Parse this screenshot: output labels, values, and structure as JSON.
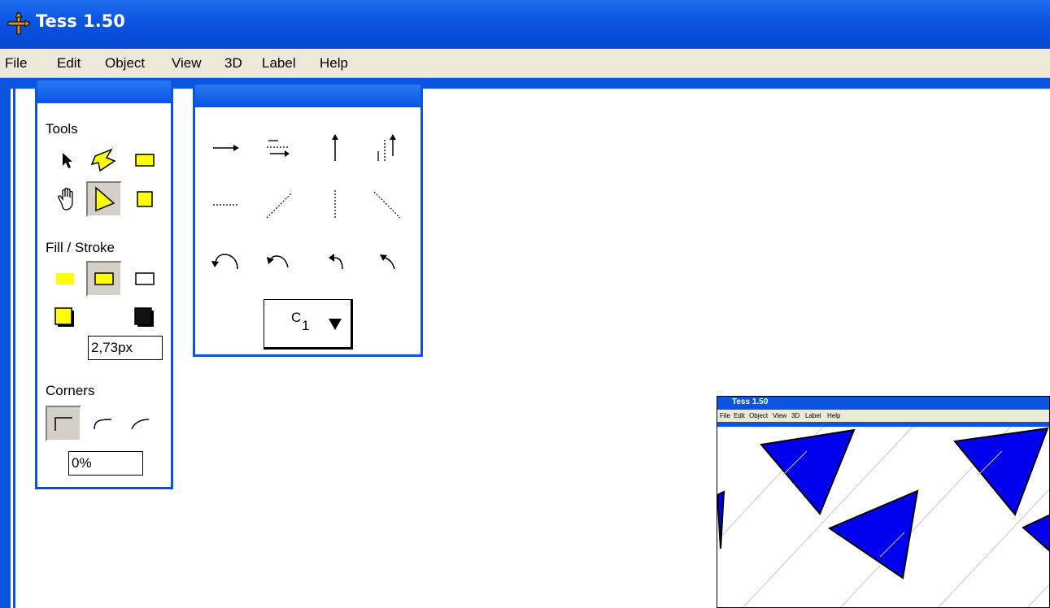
{
  "window": {
    "title": "Tess 1.50"
  },
  "menu": [
    "File",
    "Edit",
    "Object",
    "View",
    "3D",
    "Label",
    "Help"
  ],
  "tools_palette": {
    "tools_label": "Tools",
    "fill_stroke_label": "Fill / Stroke",
    "stroke_width": "2,73px",
    "corners_label": "Corners",
    "corner_radius": "0%"
  },
  "symmetry_palette": {
    "dropdown_value_letter": "C",
    "dropdown_value_sub": "1"
  },
  "thumbnail": {
    "title": "Tess 1.50",
    "menu": [
      "File",
      "Edit",
      "Object",
      "View",
      "3D",
      "Label",
      "Help"
    ],
    "fill_color": "#0000ee"
  },
  "colors": {
    "titlebar": "#0a54e0",
    "menubar": "#ece9d8",
    "tool_yellow": "#ffff00"
  }
}
